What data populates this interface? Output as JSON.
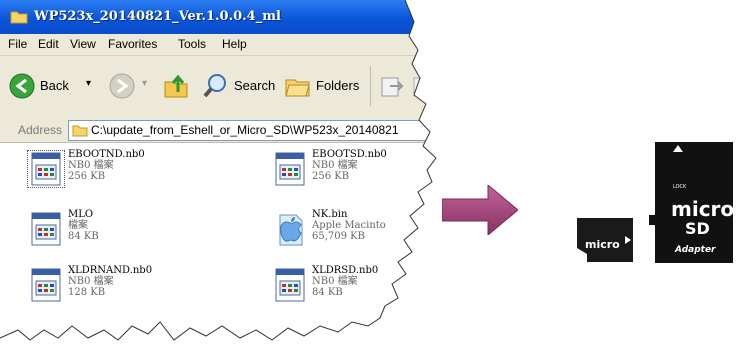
{
  "window": {
    "title": "WP523x_20140821_Ver.1.0.0.4_ml",
    "menu": [
      "File",
      "Edit",
      "View",
      "Favorites",
      "Tools",
      "Help"
    ],
    "toolbar": {
      "back": "Back",
      "search": "Search",
      "folders": "Folders"
    },
    "address": {
      "label": "Address",
      "path": "C:\\update_from_Eshell_or_Micro_SD\\WP523x_20140821"
    }
  },
  "files": [
    {
      "name": "EBOOTND.nb0",
      "type": "NB0 檔案",
      "size": "256 KB",
      "icon": "nb0-file-icon"
    },
    {
      "name": "EBOOTSD.nb0",
      "type": "NB0 檔案",
      "size": "256 KB",
      "icon": "nb0-file-icon"
    },
    {
      "name": "MLO",
      "type": "檔案",
      "size": "84 KB",
      "icon": "generic-file-icon"
    },
    {
      "name": "NK.bin",
      "type": "Apple Macinto",
      "size": "65,709 KB",
      "icon": "apple-file-icon"
    },
    {
      "name": "XLDRNAND.nb0",
      "type": "NB0 檔案",
      "size": "128 KB",
      "icon": "nb0-file-icon"
    },
    {
      "name": "XLDRSD.nb0",
      "type": "NB0 檔案",
      "size": "84 KB",
      "icon": "nb0-file-icon"
    }
  ],
  "sdcard": {
    "brand_top": "micro",
    "brand_bottom": "SD",
    "adapter": "Adapter",
    "lock": "LOCK"
  },
  "colors": {
    "titlebar": "#0a55d8",
    "arrow": "#a64a7c",
    "chrome": "#ece9d8"
  }
}
